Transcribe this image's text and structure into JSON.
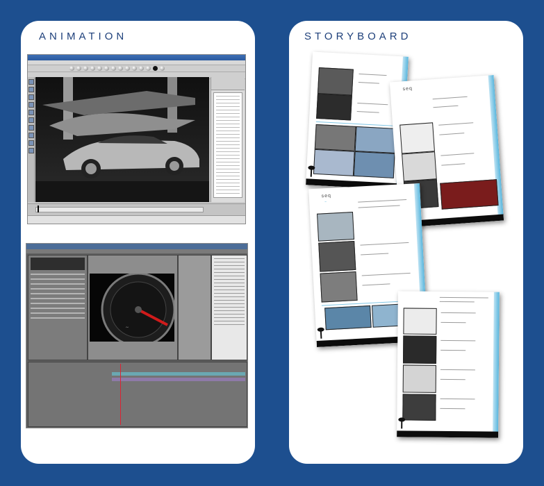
{
  "panels": {
    "animation": {
      "heading": "ANIMATION"
    },
    "storyboard": {
      "heading": "STORYBOARD"
    }
  },
  "colors": {
    "background": "#1d4f8f",
    "panel": "#ffffff",
    "heading": "#1d3f7a",
    "storyboard_accent": "#58b6dd"
  },
  "screens": {
    "maya": {
      "icon": "maya-3d-viewport-icon"
    },
    "after_effects": {
      "icon": "after-effects-composition-icon"
    }
  },
  "storyboard_pages": [
    {
      "icon": "storyboard-page-1-icon"
    },
    {
      "icon": "storyboard-page-2-icon"
    },
    {
      "icon": "storyboard-page-3-icon"
    },
    {
      "icon": "storyboard-page-4-icon"
    }
  ]
}
